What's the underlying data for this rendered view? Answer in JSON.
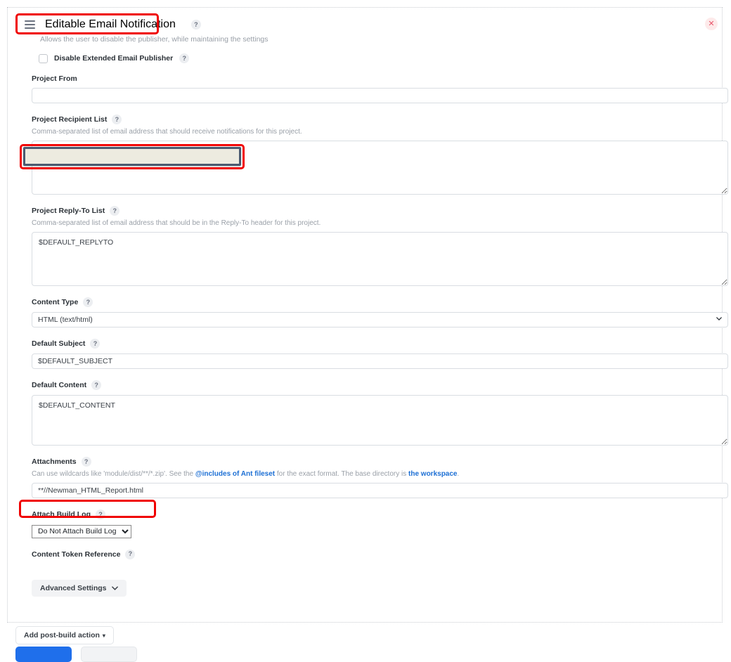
{
  "panel": {
    "title": "Editable Email Notification",
    "help_glyph": "?",
    "description": "Allows the user to disable the publisher, while maintaining the settings",
    "drag_handle_icon": "drag-handle-icon",
    "close_icon": "close-icon",
    "close_glyph": "✕"
  },
  "disable_publisher": {
    "label": "Disable Extended Email Publisher",
    "checked": false
  },
  "fields": {
    "project_from": {
      "label": "Project From",
      "value": "",
      "placeholder": ""
    },
    "project_recipient_list": {
      "label": "Project Recipient List",
      "hint": "Comma-separated list of email address that should receive notifications for this project.",
      "value": ""
    },
    "project_reply_to_list": {
      "label": "Project Reply-To List",
      "hint": "Comma-separated list of email address that should be in the Reply-To header for this project.",
      "value": "$DEFAULT_REPLYTO"
    },
    "content_type": {
      "label": "Content Type",
      "value": "HTML (text/html)",
      "options": [
        "HTML (text/html)"
      ]
    },
    "default_subject": {
      "label": "Default Subject",
      "value": "$DEFAULT_SUBJECT"
    },
    "default_content": {
      "label": "Default Content",
      "value": "$DEFAULT_CONTENT"
    },
    "attachments": {
      "label": "Attachments",
      "hint_part1": "Can use wildcards like 'module/dist/**/*.zip'. See the ",
      "hint_link1": "@includes of Ant fileset",
      "hint_part2": " for the exact format. The base directory is ",
      "hint_link2": "the workspace",
      "hint_part3": ".",
      "value": "**//Newman_HTML_Report.html"
    },
    "attach_build_log": {
      "label": "Attach Build Log",
      "value": "Do Not Attach Build Log",
      "options": [
        "Do Not Attach Build Log"
      ]
    },
    "content_token_reference": {
      "label": "Content Token Reference"
    }
  },
  "advanced_settings": {
    "label": "Advanced Settings",
    "chevron": "⌄"
  },
  "footer": {
    "add_post_build_action": "Add post-build action",
    "caret": "▾",
    "save_label": "",
    "apply_label": ""
  },
  "colors": {
    "annotation": "#f00101",
    "primary": "#1f6feb",
    "link": "#1c6fd4",
    "popup_fill": "#edebe0",
    "popup_border": "#4a5a70",
    "close_bg": "#fdeaea",
    "close_fg": "#e8566b"
  }
}
